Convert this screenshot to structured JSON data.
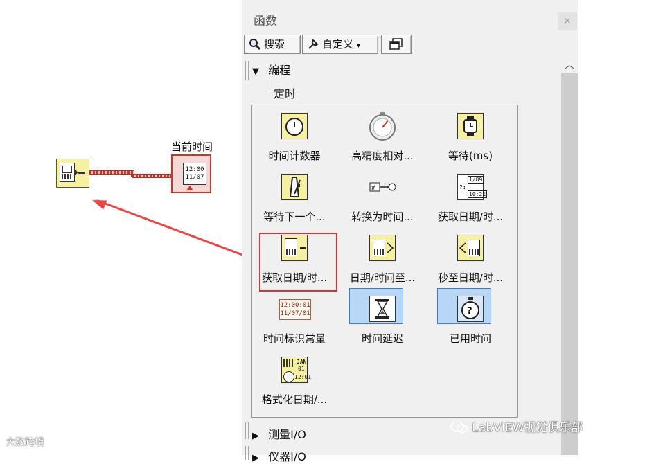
{
  "block_diagram": {
    "indicator_label": "当前时间",
    "indicator_time": "12:00",
    "indicator_date": "11/07"
  },
  "palette": {
    "title": "函数",
    "close_glyph": "×",
    "toolbar": {
      "search_label": "搜索",
      "customize_label": "自定义",
      "customize_dropdown_glyph": "▾"
    },
    "tree": {
      "expanded_category": "编程",
      "sub_category": "定时",
      "collapsed_1": "测量I/O",
      "collapsed_2": "仪器I/O"
    },
    "functions": [
      {
        "label": "时间计数器",
        "icon": "tick-count-icon"
      },
      {
        "label": "高精度相对...",
        "icon": "stopwatch-icon"
      },
      {
        "label": "等待(ms)",
        "icon": "wait-ms-icon"
      },
      {
        "label": "等待下一个...",
        "icon": "metronome-icon"
      },
      {
        "label": "转换为时间...",
        "icon": "convert-to-timestamp-icon"
      },
      {
        "label": "获取日期/时...",
        "icon": "get-date-time-string-icon"
      },
      {
        "label": "获取日期/时...",
        "icon": "get-date-time-seconds-icon"
      },
      {
        "label": "日期/时间至...",
        "icon": "date-time-to-seconds-icon"
      },
      {
        "label": "秒至日期/时...",
        "icon": "seconds-to-date-time-icon"
      },
      {
        "label": "时间标识常量",
        "icon": "timestamp-constant-icon"
      },
      {
        "label": "时间延迟",
        "icon": "hourglass-icon"
      },
      {
        "label": "已用时间",
        "icon": "elapsed-time-icon"
      },
      {
        "label": "格式化日期/...",
        "icon": "format-date-time-icon"
      }
    ],
    "timestamp_const_time": "12:00:01",
    "timestamp_const_date": "11/07/01",
    "wait_ms_note_1": "1/89",
    "wait_ms_note_2": "10:21",
    "format_month": "JAN",
    "format_day": "01",
    "format_time": "12:01"
  },
  "watermark": {
    "brand": "LabVIEW视觉俱乐部",
    "corner": "大数跨境"
  },
  "colors": {
    "wire": "#c0392b",
    "annotation_red": "#e03030",
    "selection_blue": "#b8d6f5",
    "function_yellow": "#f6f1a0"
  }
}
